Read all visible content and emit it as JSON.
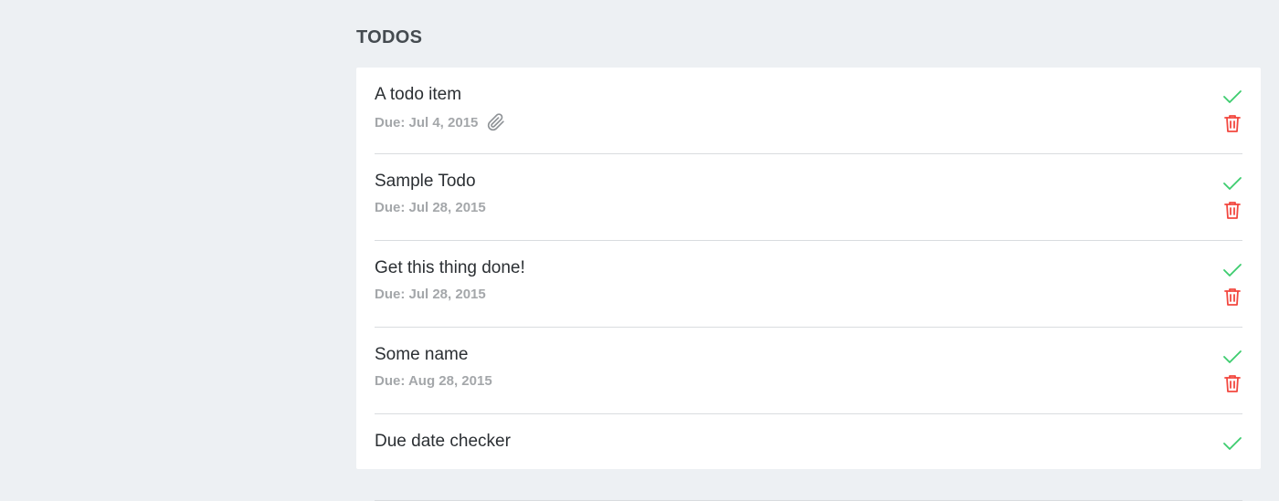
{
  "section": {
    "title": "TODOS"
  },
  "colors": {
    "page_background": "#edf0f3",
    "panel_background": "#ffffff",
    "complete_green": "#3ccc6e",
    "delete_red": "#f2473f",
    "due_gray": "#a4a7aa"
  },
  "todos": [
    {
      "title": "A todo item",
      "due": "Due: Jul 4, 2015",
      "attachment": true
    },
    {
      "title": "Sample Todo",
      "due": "Due: Jul 28, 2015",
      "attachment": false
    },
    {
      "title": "Get this thing done!",
      "due": "Due: Jul 28, 2015",
      "attachment": false
    },
    {
      "title": "Some name",
      "due": "Due: Aug 28, 2015",
      "attachment": false
    },
    {
      "title": "Due date checker",
      "due": "",
      "attachment": false
    }
  ],
  "icons": {
    "attachment": "paperclip-icon",
    "complete": "check-icon",
    "delete": "trash-icon"
  }
}
